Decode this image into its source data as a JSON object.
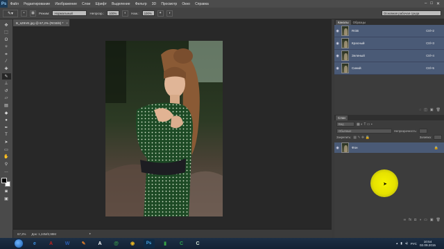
{
  "app": {
    "logo_text": "Ps"
  },
  "menu": {
    "items": [
      "Файл",
      "Редактирование",
      "Изображение",
      "Слои",
      "Шрифт",
      "Выделение",
      "Фильтр",
      "3D",
      "Просмотр",
      "Окно",
      "Справка"
    ],
    "window_buttons": {
      "minimize": "–",
      "maximize": "□",
      "close": "✕"
    }
  },
  "options_bar": {
    "mode_label": "Режим:",
    "mode_value": "Нормальный",
    "opacity_label": "Непрозр.:",
    "opacity_value": "100%",
    "flow_label": "Наж.:",
    "flow_value": "100%",
    "workspace": "Основная рабочая среда"
  },
  "document": {
    "tab_title": "B_sZ6VE.jpg @ 67,2% (RGB/8) *",
    "tab_close": "×",
    "status_zoom": "67,2%",
    "status_doc": "Док: 1,24M/2,99M"
  },
  "channels_panel": {
    "tabs": [
      "Каналы",
      "Образцы"
    ],
    "channels": [
      {
        "name": "RGB",
        "shortcut": "Ctrl+2"
      },
      {
        "name": "Красный",
        "shortcut": "Ctrl+3"
      },
      {
        "name": "Зеленый",
        "shortcut": "Ctrl+4"
      },
      {
        "name": "Синий",
        "shortcut": "Ctrl+5"
      }
    ]
  },
  "layers_panel": {
    "tab": "Слои",
    "filter_label": "Вид",
    "blend_mode": "Обычные",
    "opacity_label": "Непрозрачность:",
    "lock_label": "Закрепить:",
    "fill_label": "Заливка:",
    "layers": [
      {
        "name": "Фон",
        "locked": true
      }
    ]
  },
  "taskbar": {
    "apps": [
      {
        "name": "ie",
        "glyph": "e",
        "color": "#3b8fe0"
      },
      {
        "name": "adobe-reader",
        "glyph": "A",
        "color": "#c8221b"
      },
      {
        "name": "word",
        "glyph": "W",
        "color": "#2b5fb5"
      },
      {
        "name": "paint",
        "glyph": "✎",
        "color": "#d97b2a"
      },
      {
        "name": "a-app",
        "glyph": "A",
        "color": "#ffffff"
      },
      {
        "name": "messenger",
        "glyph": "@",
        "color": "#3aa04a"
      },
      {
        "name": "chrome",
        "glyph": "◉",
        "color": "#e6b422"
      },
      {
        "name": "photoshop",
        "glyph": "Ps",
        "color": "#4aa8e8"
      },
      {
        "name": "green-app",
        "glyph": "▮",
        "color": "#36a245"
      },
      {
        "name": "camtasia",
        "glyph": "C",
        "color": "#2fa84f"
      },
      {
        "name": "c-app",
        "glyph": "C",
        "color": "#d8e8d8"
      }
    ],
    "language": "РУС",
    "time": "10:54",
    "date": "02.09.2015"
  },
  "colors": {
    "panel_bg": "#3c3c3c",
    "selection": "#4a5a76",
    "cursor_highlight": "#f0ec00"
  }
}
